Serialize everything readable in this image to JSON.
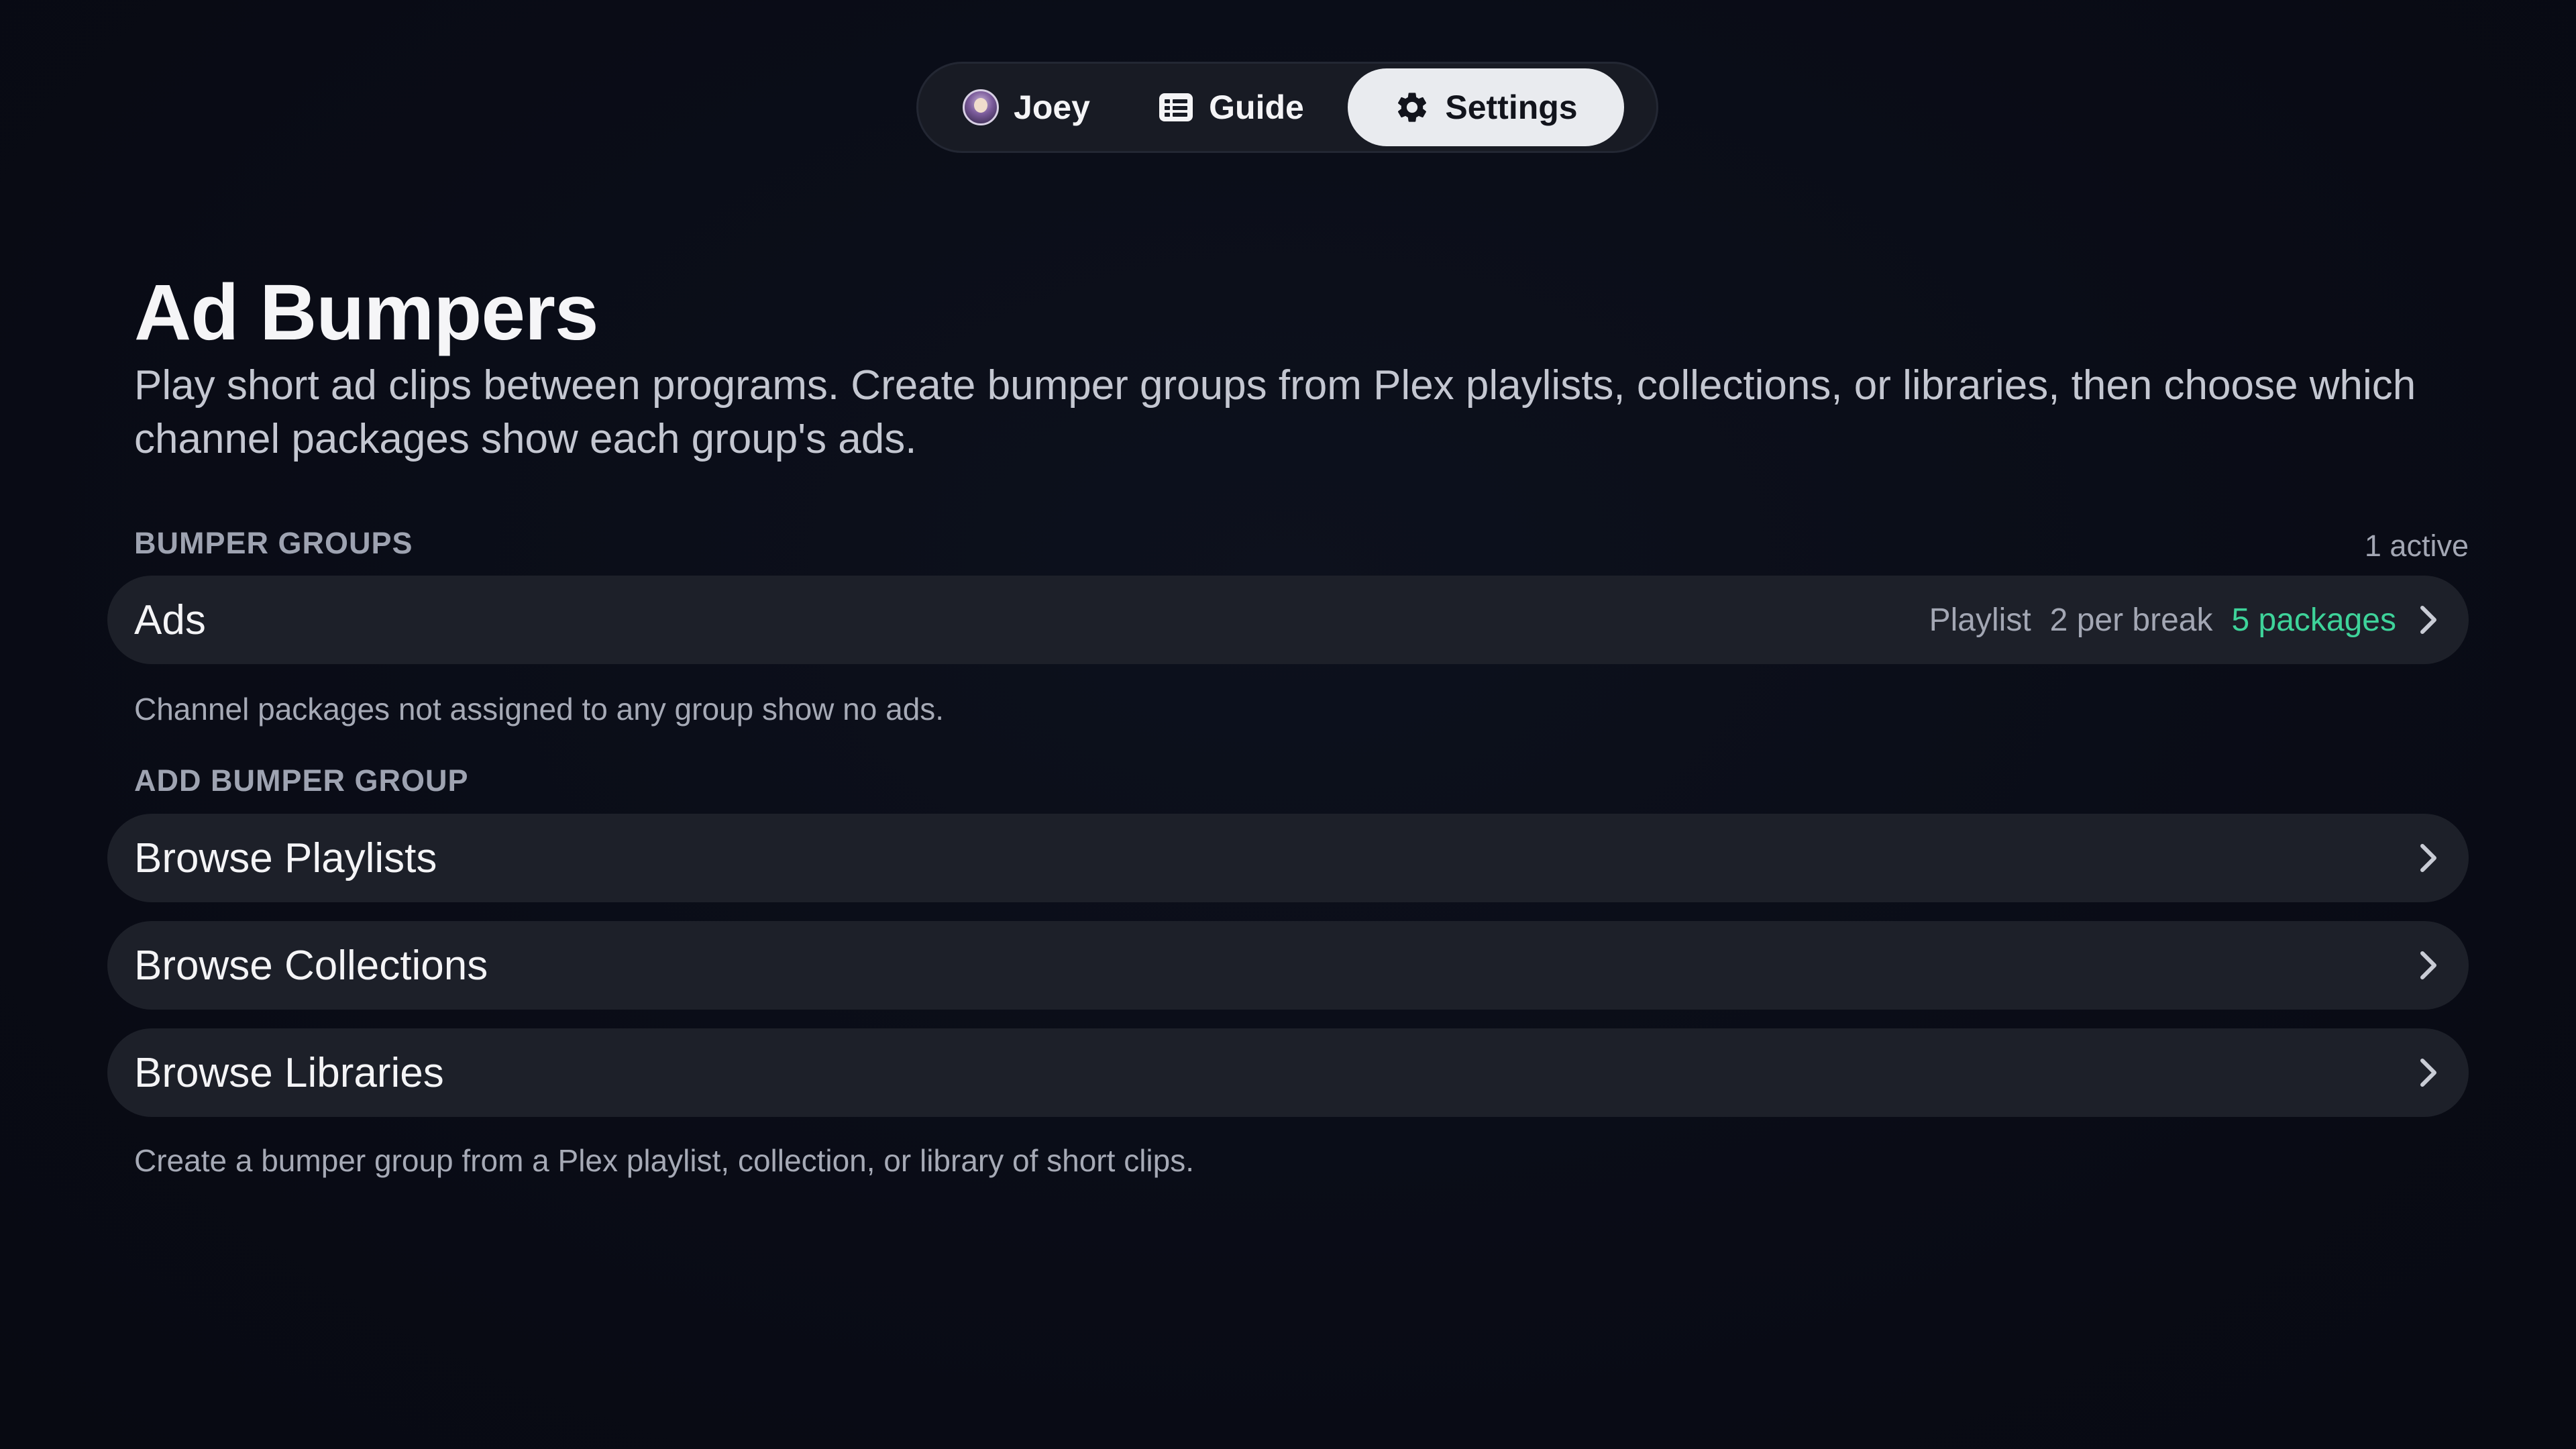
{
  "nav": {
    "user_label": "Joey",
    "guide_label": "Guide",
    "settings_label": "Settings"
  },
  "page": {
    "title": "Ad Bumpers",
    "subtitle": "Play short ad clips between programs. Create bumper groups from Plex playlists, collections, or libraries, then choose which channel packages show each group's ads."
  },
  "bumper_groups": {
    "label": "BUMPER GROUPS",
    "count_text": "1 active",
    "items": [
      {
        "name": "Ads",
        "type": "Playlist",
        "per_break": "2 per break",
        "packages": "5 packages"
      }
    ],
    "note": "Channel packages not assigned to any group show no ads."
  },
  "add_group": {
    "label": "ADD BUMPER GROUP",
    "options": [
      {
        "label": "Browse Playlists"
      },
      {
        "label": "Browse Collections"
      },
      {
        "label": "Browse Libraries"
      }
    ],
    "note": "Create a bumper group from a Plex playlist, collection, or library of short clips."
  },
  "colors": {
    "background": "#0a0c16",
    "row": "#1d2029",
    "accent_green": "#3ed39a",
    "active_tab": "#e9ebef"
  },
  "icons": {
    "user": "avatar",
    "guide": "guide-list-icon",
    "settings": "gear-icon",
    "row_arrow": "chevron-right-icon"
  }
}
